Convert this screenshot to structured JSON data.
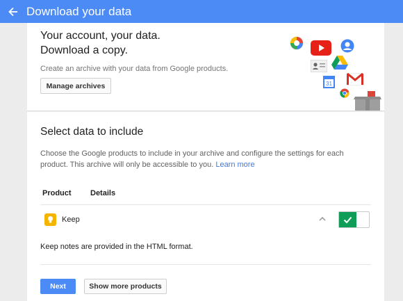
{
  "appbar": {
    "title": "Download your data",
    "back_icon": "arrow-back-icon",
    "color": "#4c8bf5"
  },
  "hero": {
    "title_line1": "Your account, your data.",
    "title_line2": "Download a copy.",
    "description": "Create an archive with your data from Google products.",
    "manage_button": "Manage archives",
    "icons": [
      "picasa-icon",
      "youtube-icon",
      "profile-icon",
      "contacts-icon",
      "drive-icon",
      "gmail-icon",
      "calendar-icon",
      "chrome-icon",
      "box-icon"
    ],
    "calendar_day": "31"
  },
  "select": {
    "title": "Select data to include",
    "description": "Choose the Google products to include in your archive and configure the settings for each product. This archive will only be accessible to you.",
    "learn_more": "Learn more",
    "columns": {
      "product": "Product",
      "details": "Details"
    },
    "product": {
      "name": "Keep",
      "icon": "keep-bulb-icon",
      "expanded": true,
      "enabled": true,
      "note": "Keep notes are provided in the HTML format."
    },
    "next_button": "Next",
    "more_button": "Show more products"
  },
  "colors": {
    "accent": "#4c8bf5",
    "toggle_on": "#0f9d58",
    "link": "#3b78e7",
    "keep": "#f4b400"
  }
}
